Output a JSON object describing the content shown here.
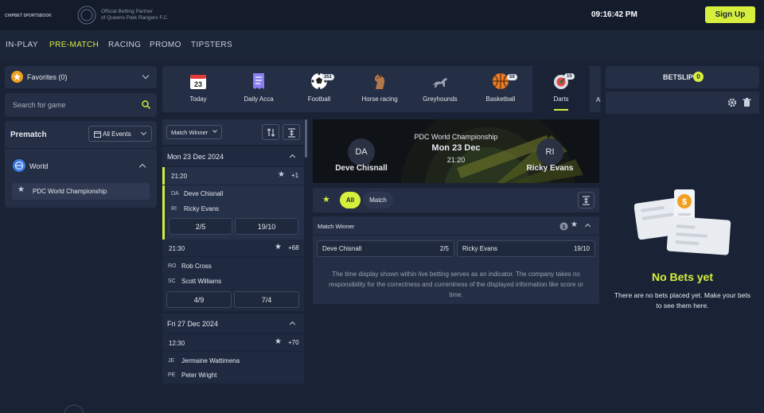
{
  "header": {
    "logo_small": "CHIPBET SPORTSBOOK",
    "partner_line1": "Official Betting Partner",
    "partner_line2": "of Queens Park Rangers F.C.",
    "clock": "09:16:42  PM",
    "signup": "Sign Up"
  },
  "nav": [
    "IN-PLAY",
    "PRE-MATCH",
    "RACING",
    "PROMO",
    "TIPSTERS"
  ],
  "left": {
    "favorites": "Favorites (0)",
    "search_placeholder": "Search for game",
    "prematch": "Prematch",
    "all_events": "All Events",
    "world": "World",
    "competition": "PDC World Championship"
  },
  "sports": [
    {
      "label": "Today",
      "badge": ""
    },
    {
      "label": "Daily Acca",
      "badge": ""
    },
    {
      "label": "Football",
      "badge": "351"
    },
    {
      "label": "Horse racing",
      "badge": ""
    },
    {
      "label": "Greyhounds",
      "badge": ""
    },
    {
      "label": "Basketball",
      "badge": "59"
    },
    {
      "label": "Darts",
      "badge": "15"
    }
  ],
  "today_day": "23",
  "list": {
    "market": "Match Winner",
    "date1": "Mon 23 Dec 2024",
    "date2": "Fri 27 Dec 2024",
    "matches": [
      {
        "time": "21:20",
        "more": "+1",
        "p1_ini": "DA",
        "p1": "Deve Chisnall",
        "p2_ini": "RI",
        "p2": "Ricky Evans",
        "o1": "2/5",
        "o2": "19/10"
      },
      {
        "time": "21:30",
        "more": "+68",
        "p1_ini": "RO",
        "p1": "Rob Cross",
        "p2_ini": "SC",
        "p2": "Scott Williams",
        "o1": "4/9",
        "o2": "7/4"
      },
      {
        "time": "12:30",
        "more": "+70",
        "p1_ini": "JE",
        "p1": "Jermaine Wattimena",
        "p2_ini": "PE",
        "p2": "Peter Wright",
        "o1": "",
        "o2": ""
      }
    ]
  },
  "event": {
    "competition": "PDC World Championship",
    "date": "Mon 23 Dec",
    "time": "21:20",
    "home_ini": "DA",
    "away_ini": "RI",
    "home": "Deve Chisnall",
    "away": "Ricky Evans",
    "tab_all": "All",
    "tab_match": "Match",
    "market": "Match Winner",
    "sel1": "Deve Chisnall",
    "sel1_odds": "2/5",
    "sel2": "Ricky Evans",
    "sel2_odds": "19/10",
    "disclaimer": "The time display shown within live betting serves as an indicator. The company takes no responsibility for the correctness and currentness of the displayed information like score or time."
  },
  "betslip": {
    "title": "BETSLIP",
    "count": "0",
    "empty_title": "No Bets yet",
    "empty_text": "There are no bets placed yet. Make your bets to see them here."
  },
  "colors": {
    "accent": "#d6ef3c",
    "bg": "#1a2336",
    "panel": "#242e44"
  }
}
